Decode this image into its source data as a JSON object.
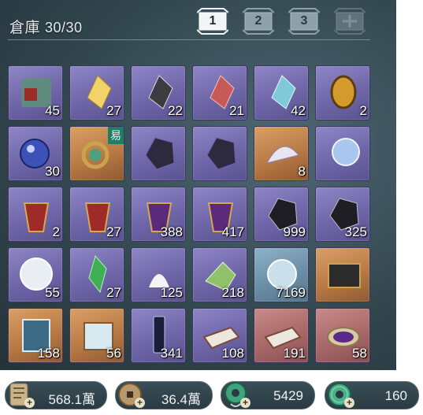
{
  "warehouse": {
    "title": "倉庫",
    "capacity": "30/30",
    "tabs": [
      {
        "label": "1",
        "active": true
      },
      {
        "label": "2",
        "active": false
      },
      {
        "label": "3",
        "active": false
      },
      {
        "label": "",
        "locked": true
      }
    ]
  },
  "items": [
    {
      "icon": "jade-seal-icon",
      "qty": "45",
      "rarity": "purple"
    },
    {
      "icon": "gold-crystal-icon",
      "qty": "27",
      "rarity": "purple"
    },
    {
      "icon": "black-crystal-icon",
      "qty": "22",
      "rarity": "purple"
    },
    {
      "icon": "red-crystal-icon",
      "qty": "21",
      "rarity": "purple"
    },
    {
      "icon": "cyan-crystal-icon",
      "qty": "42",
      "rarity": "purple"
    },
    {
      "icon": "amber-orb-icon",
      "qty": "2",
      "rarity": "purple"
    },
    {
      "icon": "blue-orb-icon",
      "qty": "30",
      "rarity": "purple"
    },
    {
      "icon": "jade-ring-icon",
      "qty": "",
      "rarity": "gold",
      "badge": "易"
    },
    {
      "icon": "dark-ore-icon",
      "qty": "",
      "rarity": "purple"
    },
    {
      "icon": "dark-ore-icon",
      "qty": "",
      "rarity": "purple"
    },
    {
      "icon": "feather-fan-icon",
      "qty": "8",
      "rarity": "gold"
    },
    {
      "icon": "pearl-orb-icon",
      "qty": "",
      "rarity": "purple"
    },
    {
      "icon": "red-pouch-icon",
      "qty": "2",
      "rarity": "purple"
    },
    {
      "icon": "red-pouch-icon",
      "qty": "27",
      "rarity": "purple"
    },
    {
      "icon": "purple-pouch-icon",
      "qty": "388",
      "rarity": "purple"
    },
    {
      "icon": "purple-pouch-icon",
      "qty": "417",
      "rarity": "purple"
    },
    {
      "icon": "black-ore-icon",
      "qty": "999",
      "rarity": "purple"
    },
    {
      "icon": "black-ore-icon",
      "qty": "325",
      "rarity": "purple"
    },
    {
      "icon": "white-pearl-icon",
      "qty": "55",
      "rarity": "purple"
    },
    {
      "icon": "green-crystal-icon",
      "qty": "27",
      "rarity": "purple"
    },
    {
      "icon": "white-powder-icon",
      "qty": "125",
      "rarity": "purple"
    },
    {
      "icon": "green-stone-icon",
      "qty": "218",
      "rarity": "purple"
    },
    {
      "icon": "spirit-pearl-icon",
      "qty": "7169",
      "rarity": "blue"
    },
    {
      "icon": "treasure-chest-icon",
      "qty": "",
      "rarity": "gold"
    },
    {
      "icon": "manual-book-icon",
      "qty": "158",
      "rarity": "gold"
    },
    {
      "icon": "scroll-icon",
      "qty": "56",
      "rarity": "gold"
    },
    {
      "icon": "talisman-icon",
      "qty": "341",
      "rarity": "purple"
    },
    {
      "icon": "paper-stack-icon",
      "qty": "108",
      "rarity": "purple"
    },
    {
      "icon": "paper-stack-icon",
      "qty": "191",
      "rarity": "red"
    },
    {
      "icon": "purple-dish-icon",
      "qty": "58",
      "rarity": "red"
    }
  ],
  "currencies": [
    {
      "icon": "silver-ingot-icon",
      "value": "568.1萬"
    },
    {
      "icon": "copper-coin-icon",
      "value": "36.4萬"
    },
    {
      "icon": "jade-coin-chain-icon",
      "value": "5429"
    },
    {
      "icon": "jade-coin-icon",
      "value": "160"
    }
  ]
}
